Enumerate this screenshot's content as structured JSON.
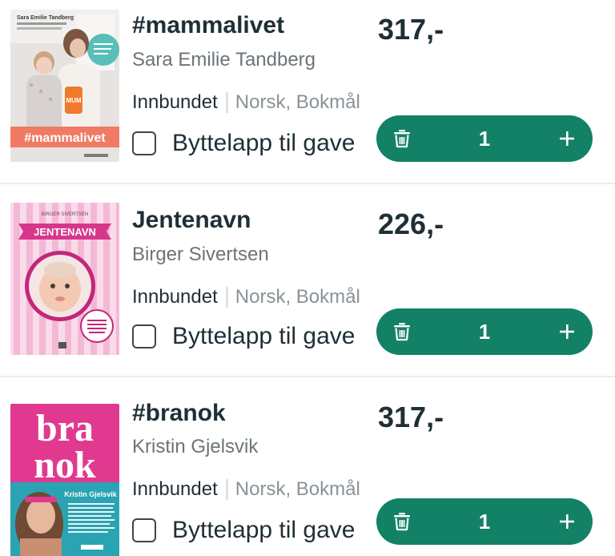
{
  "ui": {
    "accent_color": "#138166",
    "text_color": "#1f2f36",
    "muted_color": "#6b7479",
    "separator_color": "#dfe3e5"
  },
  "items": [
    {
      "title": "#mammalivet",
      "author": "Sara Emilie Tandberg",
      "binding": "Innbundet",
      "language": "Norsk, Bokmål",
      "gift_label": "Byttelapp til gave",
      "gift_checked": false,
      "price": "317,-",
      "quantity": "1",
      "cover": {
        "author_text": "Sara Emilie Tandberg",
        "title_text": "#mammalivet",
        "background": "#e7e3e0",
        "banner_color": "#f07a63",
        "icon": "book-cover-mammalivet"
      }
    },
    {
      "title": "Jentenavn",
      "author": "Birger Sivertsen",
      "binding": "Innbundet",
      "language": "Norsk, Bokmål",
      "gift_label": "Byttelapp til gave",
      "gift_checked": false,
      "price": "226,-",
      "quantity": "1",
      "cover": {
        "author_text": "BIRGER SIVERTSEN",
        "title_text": "JENTENAVN",
        "background": "#f6d0e2",
        "banner_color": "#d6378a",
        "icon": "book-cover-jentenavn"
      }
    },
    {
      "title": "#branok",
      "author": "Kristin Gjelsvik",
      "binding": "Innbundet",
      "language": "Norsk, Bokmål",
      "gift_label": "Byttelapp til gave",
      "gift_checked": false,
      "price": "317,-",
      "quantity": "1",
      "cover": {
        "line1": "bra",
        "line2": "nok",
        "author_text": "Kristin Gjelsvik",
        "background": "#e0398f",
        "bottom_color": "#2aa3b3",
        "icon": "book-cover-branok"
      }
    }
  ]
}
